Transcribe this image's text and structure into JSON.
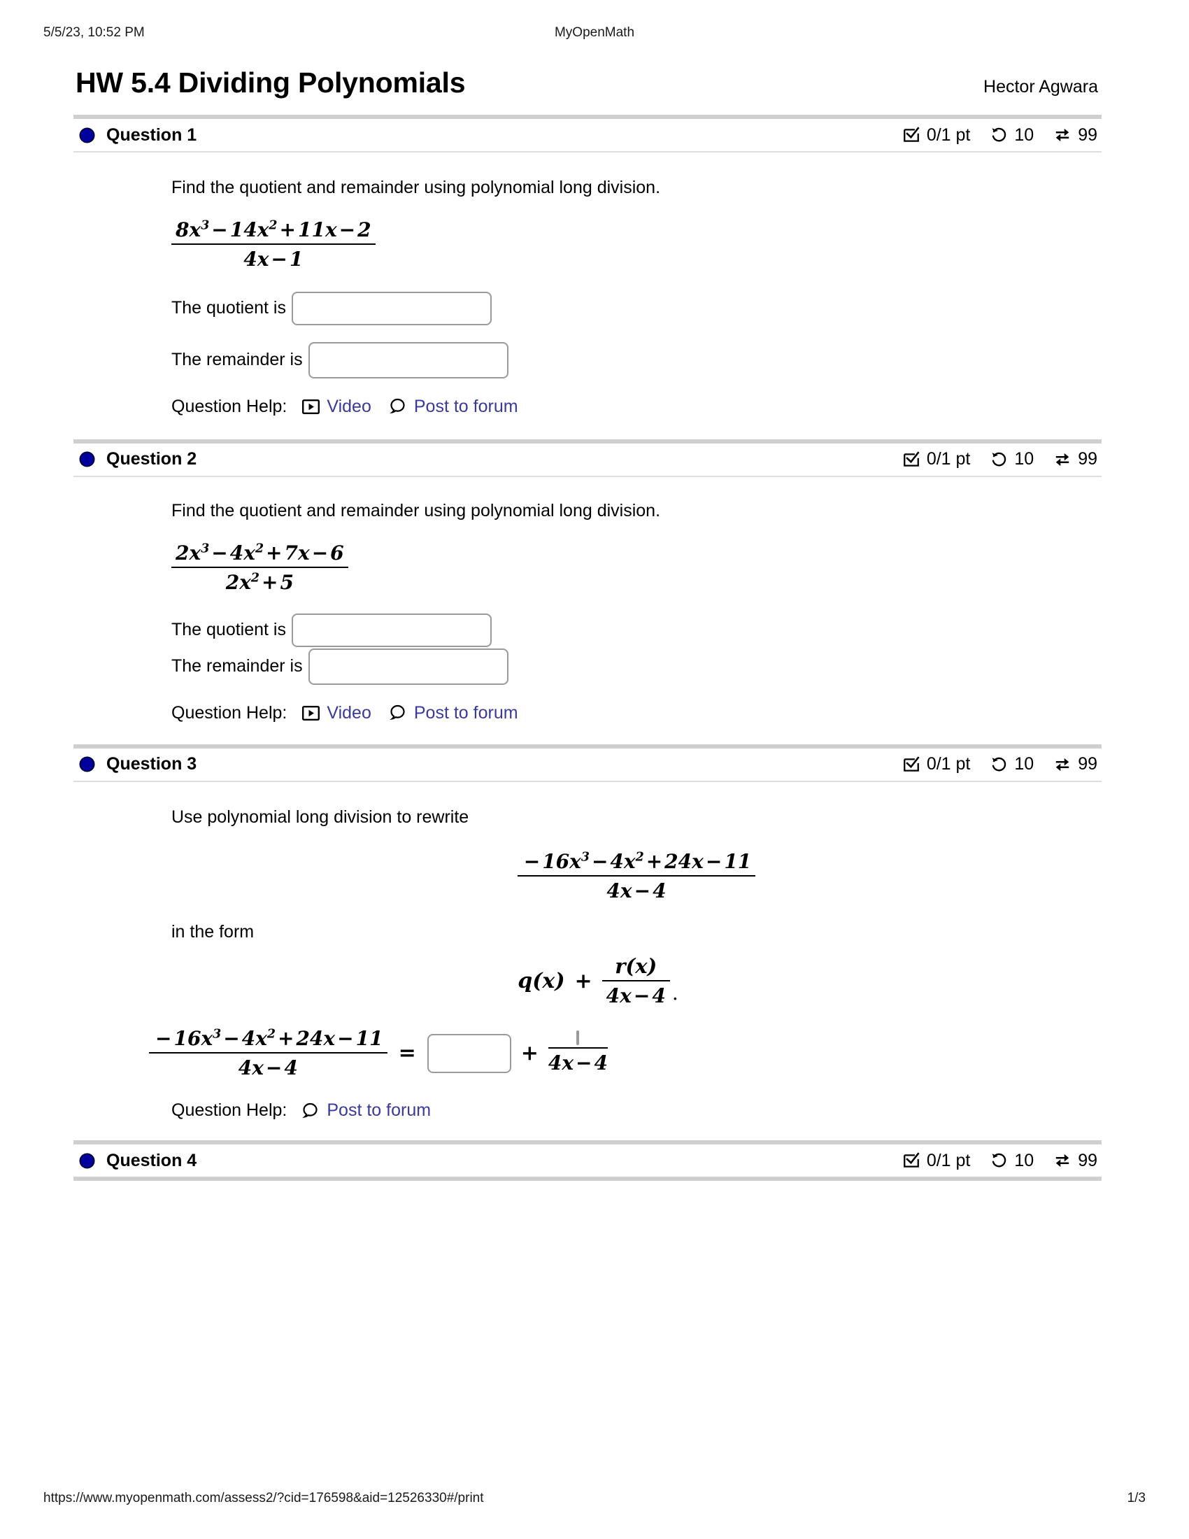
{
  "print_header": {
    "timestamp": "5/5/23, 10:52 PM",
    "site_name": "MyOpenMath"
  },
  "print_footer": {
    "url": "https://www.myopenmath.com/assess2/?cid=176598&aid=12526330#/print",
    "page_number": "1/3"
  },
  "document": {
    "title": "HW 5.4 Dividing Polynomials",
    "student_name": "Hector Agwara"
  },
  "colors": {
    "question_dot": "#00009c",
    "link": "#3a3a9c",
    "separator": "#cfcfcf",
    "input_border": "#9a9a9a"
  },
  "labels": {
    "question_help": "Question Help:",
    "video_link": "Video",
    "forum_link": "Post to forum",
    "quotient_label": "The quotient is",
    "remainder_label": "The remainder is",
    "in_the_form": "in the form"
  },
  "questions": [
    {
      "label": "Question 1",
      "points": "0/1 pt",
      "attempts": "10",
      "versions": "99",
      "prompt": "Find the quotient and remainder using polynomial long division.",
      "fraction": {
        "numerator": "8x³ − 14x² + 11x − 2",
        "denominator": "4x − 1"
      },
      "num_parts": [
        {
          "coef": "8",
          "var": "x",
          "exp": "3"
        },
        {
          "op": "−",
          "coef": "14",
          "var": "x",
          "exp": "2"
        },
        {
          "op": "+",
          "coef": "11",
          "var": "x",
          "exp": ""
        },
        {
          "op": "−",
          "coef": "2",
          "var": "",
          "exp": ""
        }
      ],
      "help_links": [
        "Video",
        "Post to forum"
      ]
    },
    {
      "label": "Question 2",
      "points": "0/1 pt",
      "attempts": "10",
      "versions": "99",
      "prompt": "Find the quotient and remainder using polynomial long division.",
      "fraction": {
        "numerator": "2x³ − 4x² + 7x − 6",
        "denominator": "2x² + 5"
      },
      "help_links": [
        "Video",
        "Post to forum"
      ]
    },
    {
      "label": "Question 3",
      "points": "0/1 pt",
      "attempts": "10",
      "versions": "99",
      "prompt": "Use polynomial long division to rewrite",
      "fraction": {
        "numerator": "−16x³ − 4x² + 24x − 11",
        "denominator": "4x − 4"
      },
      "form_expression": "q(x) + r(x)/(4x − 4) .",
      "form_q": "q(x)",
      "form_plus": "+",
      "form_r_num": "r(x)",
      "form_r_den": "4x − 4",
      "form_period": ".",
      "help_links": [
        "Post to forum"
      ]
    },
    {
      "label": "Question 4",
      "points": "0/1 pt",
      "attempts": "10",
      "versions": "99"
    }
  ],
  "icons": {
    "checkbox": "checkbox-checked-icon",
    "retry": "rotate-left-icon",
    "swap": "exchange-arrows-icon",
    "video": "video-play-icon",
    "forum": "speech-bubble-icon",
    "question_dot": "question-status-dot"
  }
}
